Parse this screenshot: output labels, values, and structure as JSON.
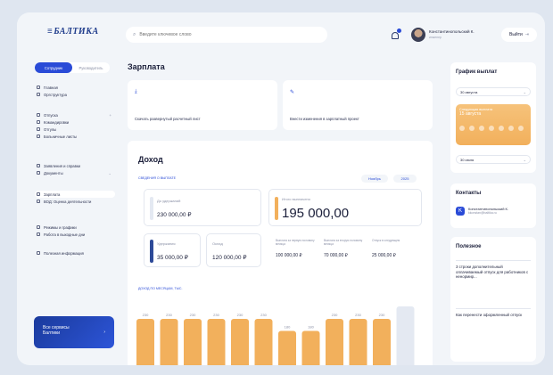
{
  "header": {
    "logo": "БАЛТИКА",
    "search_placeholder": "Введите ключевое слово",
    "user_name": "Константинопольский К.",
    "user_role": "инженер",
    "logout": "Выйти"
  },
  "sidebar": {
    "toggle": [
      "Сотрудник",
      "Руководитель"
    ],
    "groups": [
      [
        "Главная",
        "Оргструктура"
      ],
      [
        "Отпуска",
        "Командировки",
        "Отгулы",
        "Больничные листы"
      ],
      [
        "Заявления и справки",
        "Документы"
      ],
      [
        "Зарплата",
        "ВОД: Оценка деятельности"
      ],
      [
        "Режимы и графики",
        "Работа в выходные дни"
      ],
      [
        "Полезная информация"
      ]
    ],
    "promo": "Все сервисы Балтики"
  },
  "main": {
    "title": "Зарплата",
    "actions": [
      "Скачать развернутый расчетный лист",
      "Внести изменения в зарплатный проект"
    ],
    "income": {
      "title": "Доход",
      "subtitle": "Сведения о выплате",
      "month": "Ноябрь",
      "year": "2025",
      "before_tax_label": "До удержаний",
      "before_tax_value": "230 000,00 ₽",
      "total_label": "Итого выплачено",
      "total_value": "195 000,00",
      "deductions_label": "Удержания",
      "deductions_value": "35 000,00 ₽",
      "salary_label": "Оклад",
      "salary_value": "120 000,00 ₽",
      "p1_label": "Выплата за первую половину месяца",
      "p1_value": "100 000,00 ₽",
      "p2_label": "Выплата за вторую половину месяца",
      "p2_value": "70 000,00 ₽",
      "p3_label": "Отпуск в следующем",
      "p3_value": "25 000,00 ₽",
      "chart_title": "Доход по месяцам, тыс."
    }
  },
  "chart_data": {
    "type": "bar",
    "categories": [
      "",
      "",
      "",
      "",
      "",
      "",
      "",
      "",
      "",
      "",
      "",
      ""
    ],
    "series": [
      {
        "values": [
          230,
          230,
          230,
          230,
          230,
          230,
          180,
          180,
          230,
          230,
          230,
          null
        ]
      },
      {
        "values": [
          30,
          30,
          30,
          30,
          30,
          30,
          25,
          25,
          30,
          30,
          30,
          25
        ]
      }
    ],
    "colors": {
      "main": "#f2b05c",
      "deduction": "#2d4a98",
      "future": "#e4e9f2"
    }
  },
  "right": {
    "schedule_title": "График выплат",
    "schedule_month": "30 августа",
    "schedule_card_line1": "Следующая выплата",
    "schedule_card_line2": "15 августа",
    "schedule_month2": "30 июля",
    "contacts_title": "Контакты",
    "contact_name": "Константинопольский К.",
    "contact_email": "kkonstan@baltika.ru",
    "useful_title": "Полезное",
    "useful_items": [
      "3 строки дополнительный оплачиваемый отпуск для работников с ненормир...",
      "Как перенести оформленный отпуск"
    ]
  }
}
